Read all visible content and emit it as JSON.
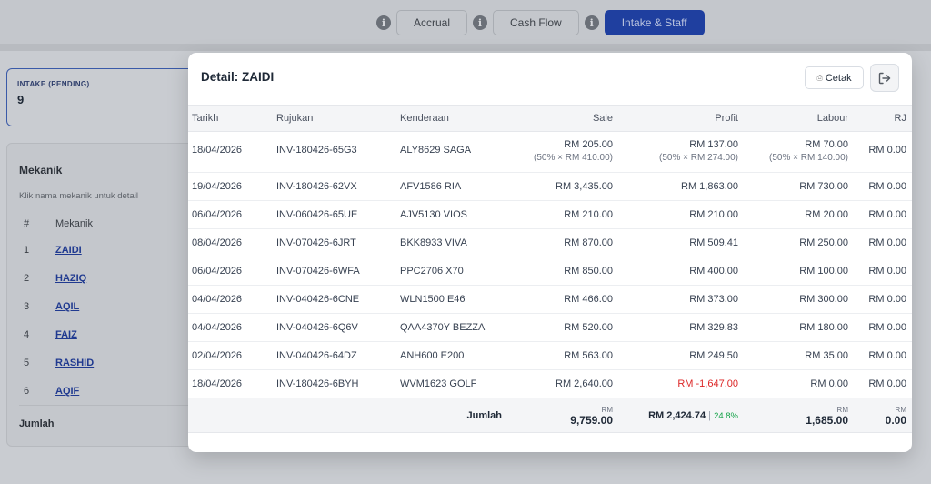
{
  "tabs": {
    "accrual": "Accrual",
    "cash_flow": "Cash Flow",
    "intake_staff": "Intake & Staff",
    "info": "i"
  },
  "intake": {
    "label": "INTAKE (PENDING)",
    "value": "9"
  },
  "mekanik": {
    "title": "Mekanik",
    "hint": "Klik nama mekanik untuk detail",
    "col_no": "#",
    "col_name": "Mekanik",
    "rows": [
      {
        "no": "1",
        "name": "ZAIDI"
      },
      {
        "no": "2",
        "name": "HAZIQ"
      },
      {
        "no": "3",
        "name": "AQIL"
      },
      {
        "no": "4",
        "name": "FAIZ"
      },
      {
        "no": "5",
        "name": "RASHID"
      },
      {
        "no": "6",
        "name": "AQIF"
      }
    ],
    "footer": "Jumlah"
  },
  "modal": {
    "title": "Detail: ZAIDI",
    "print_label": "Cetak",
    "print_icon": "printer-icon",
    "close_icon": "logout-icon",
    "columns": {
      "tarikh": "Tarikh",
      "rujukan": "Rujukan",
      "kenderaan": "Kenderaan",
      "sale": "Sale",
      "profit": "Profit",
      "labour": "Labour",
      "rj": "RJ"
    },
    "rows": [
      {
        "tarikh": "18/04/2026",
        "rujukan": "INV-180426-65G3",
        "kenderaan": "ALY8629 SAGA",
        "sale": "RM 205.00",
        "sale_sub": "(50% × RM 410.00)",
        "profit": "RM 137.00",
        "profit_sub": "(50% × RM 274.00)",
        "labour": "RM 70.00",
        "labour_sub": "(50% × RM 140.00)",
        "rj": "RM 0.00"
      },
      {
        "tarikh": "19/04/2026",
        "rujukan": "INV-180426-62VX",
        "kenderaan": "AFV1586 RIA",
        "sale": "RM 3,435.00",
        "profit": "RM 1,863.00",
        "labour": "RM 730.00",
        "rj": "RM 0.00"
      },
      {
        "tarikh": "06/04/2026",
        "rujukan": "INV-060426-65UE",
        "kenderaan": "AJV5130 VIOS",
        "sale": "RM 210.00",
        "profit": "RM 210.00",
        "labour": "RM 20.00",
        "rj": "RM 0.00"
      },
      {
        "tarikh": "08/04/2026",
        "rujukan": "INV-070426-6JRT",
        "kenderaan": "BKK8933 VIVA",
        "sale": "RM 870.00",
        "profit": "RM 509.41",
        "labour": "RM 250.00",
        "rj": "RM 0.00"
      },
      {
        "tarikh": "06/04/2026",
        "rujukan": "INV-070426-6WFA",
        "kenderaan": "PPC2706 X70",
        "sale": "RM 850.00",
        "profit": "RM 400.00",
        "labour": "RM 100.00",
        "rj": "RM 0.00"
      },
      {
        "tarikh": "04/04/2026",
        "rujukan": "INV-040426-6CNE",
        "kenderaan": "WLN1500 E46",
        "sale": "RM 466.00",
        "profit": "RM 373.00",
        "labour": "RM 300.00",
        "rj": "RM 0.00"
      },
      {
        "tarikh": "04/04/2026",
        "rujukan": "INV-040426-6Q6V",
        "kenderaan": "QAA4370Y BEZZA",
        "sale": "RM 520.00",
        "profit": "RM 329.83",
        "labour": "RM 180.00",
        "rj": "RM 0.00"
      },
      {
        "tarikh": "02/04/2026",
        "rujukan": "INV-040426-64DZ",
        "kenderaan": "ANH600 E200",
        "sale": "RM 563.00",
        "profit": "RM 249.50",
        "labour": "RM 35.00",
        "rj": "RM 0.00"
      },
      {
        "tarikh": "18/04/2026",
        "rujukan": "INV-180426-6BYH",
        "kenderaan": "WVM1623 GOLF",
        "sale": "RM 2,640.00",
        "profit": "RM -1,647.00",
        "profit_negative": true,
        "labour": "RM 0.00",
        "rj": "RM 0.00"
      }
    ],
    "total": {
      "label": "Jumlah",
      "currency": "RM",
      "sale": "9,759.00",
      "profit": "RM 2,424.74",
      "profit_sep": "|",
      "profit_pct": "24.8%",
      "labour": "1,685.00",
      "rj": "0.00"
    }
  },
  "colors": {
    "accent": "#1f3f9f",
    "negative": "#dc2626",
    "positive": "#16a34a"
  }
}
